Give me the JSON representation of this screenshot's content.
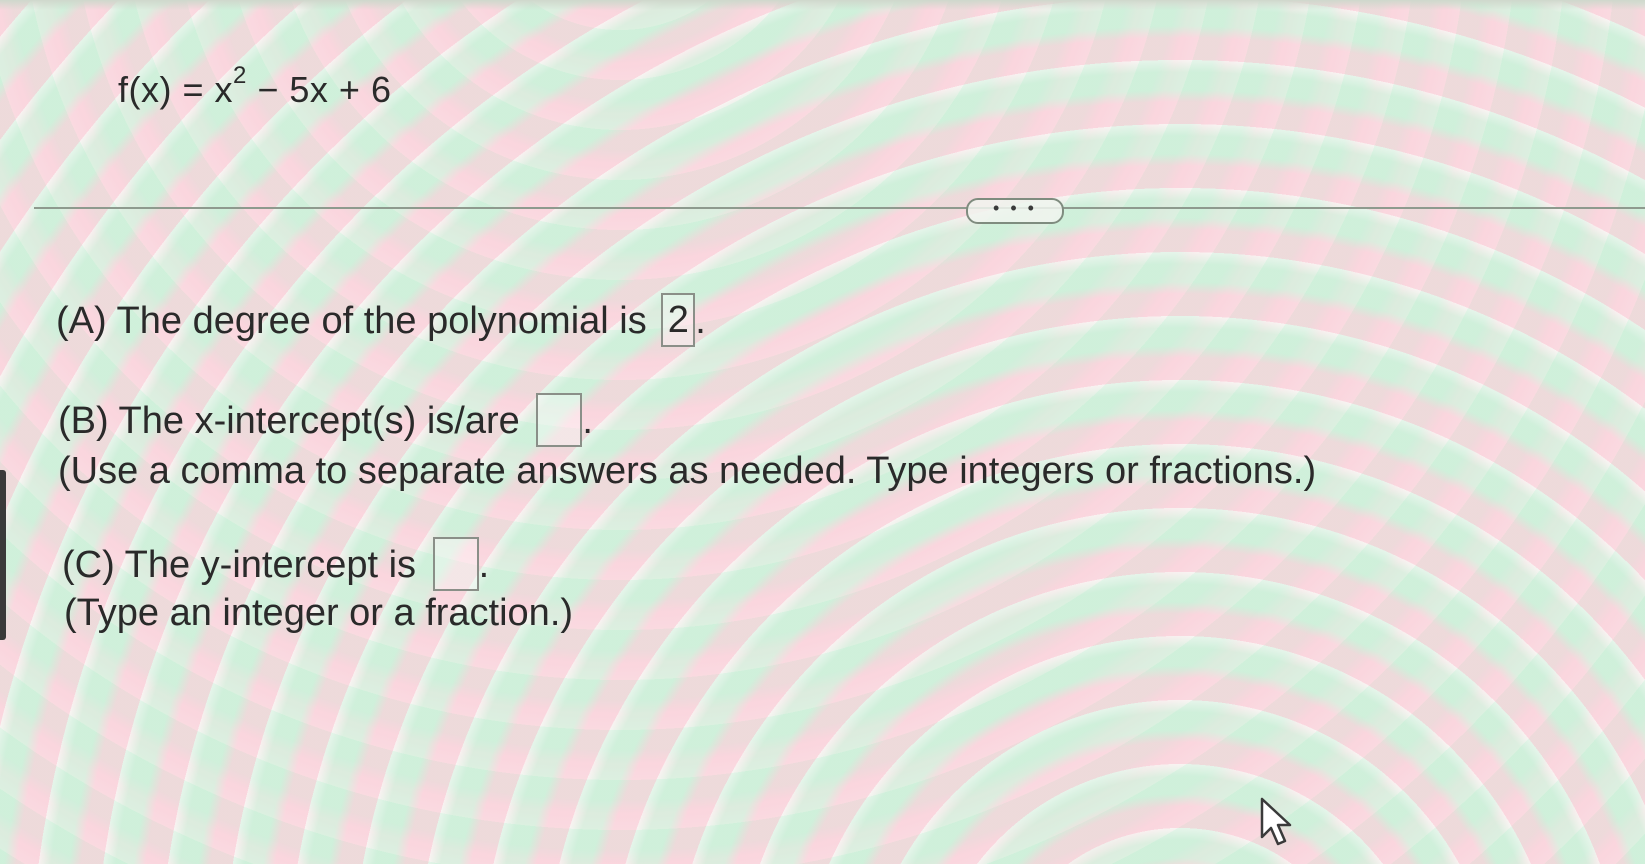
{
  "equation": {
    "lhs": "f(x) = x",
    "exponent": "2",
    "rhs": " − 5x + 6"
  },
  "more_button": {
    "label": "• • •"
  },
  "part_a": {
    "prefix": "(A) The degree of the polynomial is",
    "answer": "2",
    "suffix": "."
  },
  "part_b": {
    "prefix": "(B) The x-intercept(s) is/are",
    "answer": "",
    "suffix": ".",
    "hint": "(Use a comma to separate answers as needed. Type integers or fractions.)"
  },
  "part_c": {
    "prefix": "(C) The y-intercept is",
    "answer": "",
    "suffix": ".",
    "hint": "(Type an integer or a fraction.)"
  },
  "icons": {
    "cursor": "mouse-pointer-icon"
  }
}
